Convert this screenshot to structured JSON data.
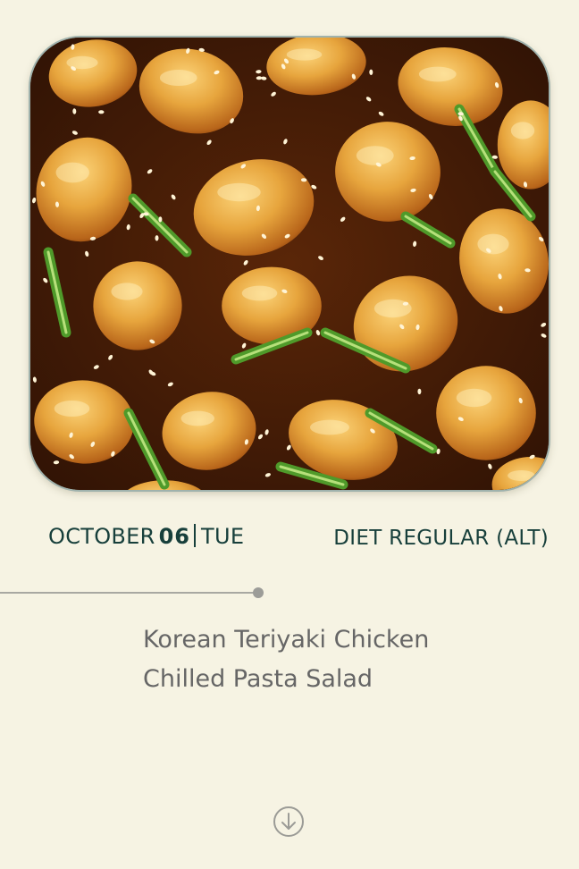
{
  "hero": {
    "image_alt": "Korean teriyaki chicken glazed with sesame seeds and green onions"
  },
  "date": {
    "month": "OCTOBER",
    "day": "06",
    "weekday": "TUE"
  },
  "diet": {
    "label": "DIET REGULAR (ALT)"
  },
  "menu": {
    "items": [
      "Korean Teriyaki Chicken",
      "Chilled Pasta Salad"
    ]
  },
  "icons": {
    "scroll": "arrow-down-circle-icon"
  },
  "colors": {
    "background": "#f6f3e3",
    "accent_text": "#173f3b",
    "menu_text": "#666666"
  }
}
